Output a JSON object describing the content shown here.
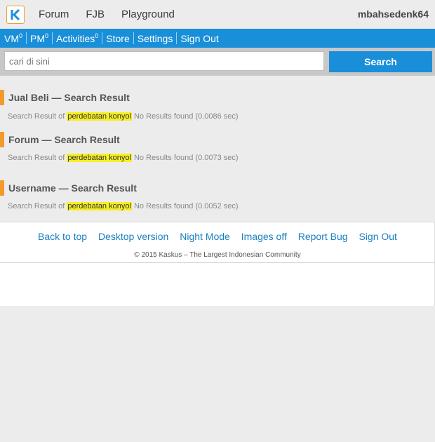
{
  "header": {
    "nav": [
      "Forum",
      "FJB",
      "Playground"
    ],
    "username": "mbahsedenk64"
  },
  "userbar": {
    "vm": "VM",
    "vm_count": "0",
    "pm": "PM",
    "pm_count": "0",
    "activities": "Activities",
    "activities_count": "0",
    "store": "Store",
    "settings": "Settings",
    "signout": "Sign Out"
  },
  "search": {
    "placeholder": "cari di sini",
    "button": "Search"
  },
  "results": [
    {
      "title": "Jual Beli — Search Result",
      "prefix": "Search Result of",
      "query": "perdebatan konyol",
      "status": "No Results found (0.0086 sec)"
    },
    {
      "title": "Forum — Search Result",
      "prefix": "Search Result of",
      "query": "perdebatan konyol",
      "status": "No Results found (0.0073 sec)"
    },
    {
      "title": "Username — Search Result",
      "prefix": "Search Result of",
      "query": "perdebatan konyol",
      "status": "No Results found (0.0052 sec)"
    }
  ],
  "footer": {
    "links": [
      "Back to top",
      "Desktop version",
      "Night Mode",
      "Images off",
      "Report Bug",
      "Sign Out"
    ],
    "copyright": "© 2015 Kaskus – The Largest Indonesian Community"
  },
  "colors": {
    "accent_blue": "#1a8fd9",
    "accent_orange": "#f39a2b",
    "highlight": "#f7ef23"
  }
}
